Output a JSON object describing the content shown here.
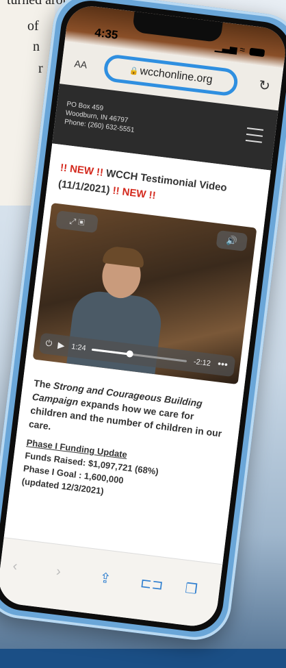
{
  "background_article": {
    "fragments": [
      "turned around when",
      "of",
      "n",
      "r",
      ".",
      "."
    ]
  },
  "phone": {
    "status": {
      "time": "4:35",
      "signal_icon": "signal-icon",
      "wifi_icon": "wifi-icon",
      "battery_icon": "battery-icon"
    },
    "browser": {
      "aa_label": "AA",
      "url": "wcchonline.org",
      "reload_icon": "reload-icon",
      "toolbar_icons": [
        "back-icon",
        "forward-icon",
        "share-icon",
        "bookmarks-icon",
        "tabs-icon"
      ]
    },
    "site": {
      "address_line1": "PO Box 459",
      "address_line2": "Woodburn, IN 46797",
      "phone": "Phone: (260) 632-5551",
      "new_badge": "!! NEW !!",
      "headline": "WCCH Testimonial Video",
      "headline_date": "(11/1/2021)",
      "video": {
        "current_time": "1:24",
        "remaining_time": "-2:12",
        "progress": 0.4
      },
      "campaign_prefix": "The ",
      "campaign_name": "Strong and Courageous Building Campaign",
      "campaign_suffix": " expands how we care for children and the number of children in our care.",
      "funding_header": "Phase I Funding Update",
      "funds_raised": "Funds Raised: $1,097,721 (68%)",
      "phase_goal": "Phase I Goal : 1,600,000",
      "updated": "(updated 12/3/2021)"
    }
  },
  "colors": {
    "frame": "#6aa6d8",
    "highlight_circle": "#2f8fe0",
    "new_red": "#d42a1e",
    "header_bg": "#2c2c2c"
  }
}
